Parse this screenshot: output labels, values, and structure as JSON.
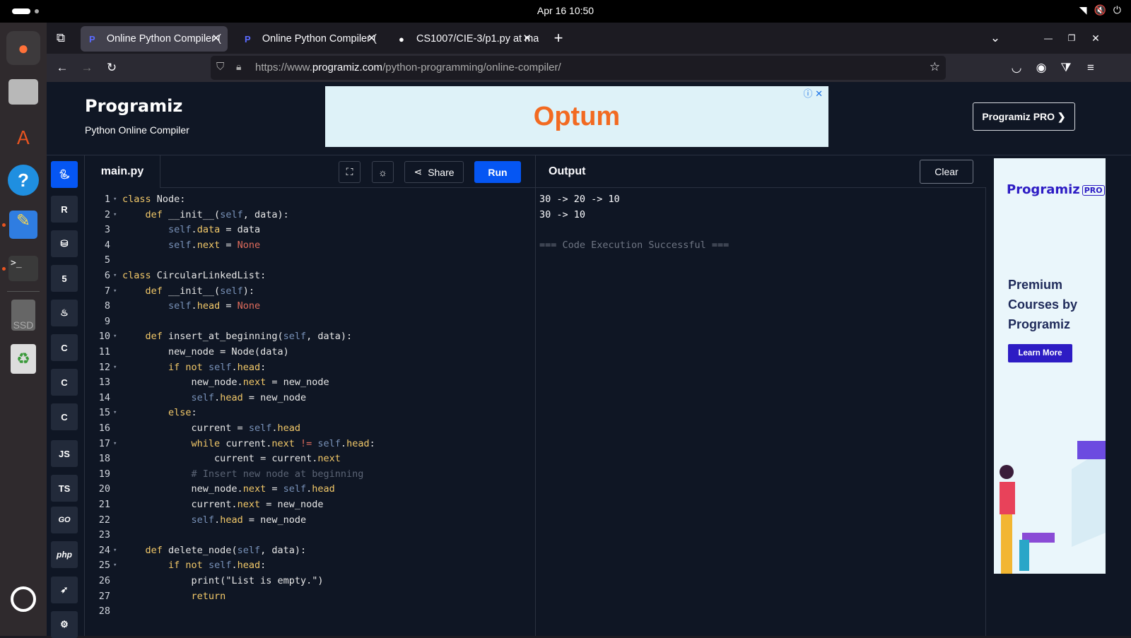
{
  "os": {
    "clock": "Apr 16  10:50"
  },
  "dock": {
    "items": [
      "firefox-icon",
      "files-icon",
      "app-center-icon",
      "help-icon",
      "text-editor-icon",
      "terminal-icon",
      "ssd-drive-icon",
      "trash-icon",
      "ubuntu-apps-icon"
    ],
    "ssd_label": "SSD"
  },
  "browser": {
    "tabs": [
      {
        "title": "Online Python Compiler (",
        "active": true
      },
      {
        "title": "Online Python Compiler (",
        "active": false
      },
      {
        "title": "CS1007/CIE-3/p1.py at ma",
        "active": false
      }
    ],
    "url_prefix": "https://www.",
    "url_domain": "programiz.com",
    "url_path": "/python-programming/online-compiler/"
  },
  "site": {
    "logo": "Programiz",
    "subtitle": "Python Online Compiler",
    "ad_brand": "Optum",
    "pro_button": "Programiz PRO ❯"
  },
  "languages": [
    "python",
    "R",
    "sql",
    "html",
    "java",
    "C",
    "C++",
    "C#",
    "JS",
    "TS",
    "GO",
    "php",
    "swift",
    "rust"
  ],
  "editor": {
    "filename": "main.py",
    "share_label": "Share",
    "run_label": "Run",
    "lines": [
      {
        "n": "1",
        "fold": true,
        "html": "<span class='kw'>class</span> Node:"
      },
      {
        "n": "2",
        "fold": true,
        "html": "    <span class='kw'>def</span> __init__(<span class='sf'>self</span>, data):"
      },
      {
        "n": "3",
        "fold": false,
        "html": "        <span class='sf'>self</span>.<span class='kw'>data</span> = data"
      },
      {
        "n": "4",
        "fold": false,
        "html": "        <span class='sf'>self</span>.<span class='kw'>next</span> = <span class='nm'>None</span>"
      },
      {
        "n": "5",
        "fold": false,
        "html": ""
      },
      {
        "n": "6",
        "fold": true,
        "html": "<span class='kw'>class</span> CircularLinkedList:"
      },
      {
        "n": "7",
        "fold": true,
        "html": "    <span class='kw'>def</span> __init__(<span class='sf'>self</span>):"
      },
      {
        "n": "8",
        "fold": false,
        "html": "        <span class='sf'>self</span>.<span class='kw'>head</span> = <span class='nm'>None</span>"
      },
      {
        "n": "9",
        "fold": false,
        "html": ""
      },
      {
        "n": "10",
        "fold": true,
        "html": "    <span class='kw'>def</span> insert_at_beginning(<span class='sf'>self</span>, data):"
      },
      {
        "n": "11",
        "fold": false,
        "html": "        new_node = Node(data)"
      },
      {
        "n": "12",
        "fold": true,
        "html": "        <span class='kw'>if not</span> <span class='sf'>self</span>.<span class='kw'>head</span>:"
      },
      {
        "n": "13",
        "fold": false,
        "html": "            new_node.<span class='kw'>next</span> = new_node"
      },
      {
        "n": "14",
        "fold": false,
        "html": "            <span class='sf'>self</span>.<span class='kw'>head</span> = new_node"
      },
      {
        "n": "15",
        "fold": true,
        "html": "        <span class='kw'>else</span>:"
      },
      {
        "n": "16",
        "fold": false,
        "html": "            current = <span class='sf'>self</span>.<span class='kw'>head</span>"
      },
      {
        "n": "17",
        "fold": true,
        "html": "            <span class='kw'>while</span> current.<span class='kw'>next</span> <span class='op'>!=</span> <span class='sf'>self</span>.<span class='kw'>head</span>:"
      },
      {
        "n": "18",
        "fold": false,
        "html": "                current = current.<span class='kw'>next</span>"
      },
      {
        "n": "19",
        "fold": false,
        "html": "            <span class='cm'># Insert new node at beginning</span>"
      },
      {
        "n": "20",
        "fold": false,
        "html": "            new_node.<span class='kw'>next</span> = <span class='sf'>self</span>.<span class='kw'>head</span>"
      },
      {
        "n": "21",
        "fold": false,
        "html": "            current.<span class='kw'>next</span> = new_node"
      },
      {
        "n": "22",
        "fold": false,
        "html": "            <span class='sf'>self</span>.<span class='kw'>head</span> = new_node"
      },
      {
        "n": "23",
        "fold": false,
        "html": ""
      },
      {
        "n": "24",
        "fold": true,
        "html": "    <span class='kw'>def</span> delete_node(<span class='sf'>self</span>, data):"
      },
      {
        "n": "25",
        "fold": true,
        "html": "        <span class='kw'>if not</span> <span class='sf'>self</span>.<span class='kw'>head</span>:"
      },
      {
        "n": "26",
        "fold": false,
        "html": "            print(<span class='st'>\"List is empty.\"</span>)"
      },
      {
        "n": "27",
        "fold": false,
        "html": "            <span class='kw'>return</span>"
      },
      {
        "n": "28",
        "fold": false,
        "html": ""
      }
    ]
  },
  "output": {
    "title": "Output",
    "clear_label": "Clear",
    "lines": [
      "30 -> 20 -> 10",
      "30 -> 10",
      "",
      "=== Code Execution Successful ==="
    ]
  },
  "side_ad": {
    "logo": "Programiz",
    "badge": "PRO",
    "headline": "Premium Courses by Programiz",
    "cta": "Learn More"
  }
}
